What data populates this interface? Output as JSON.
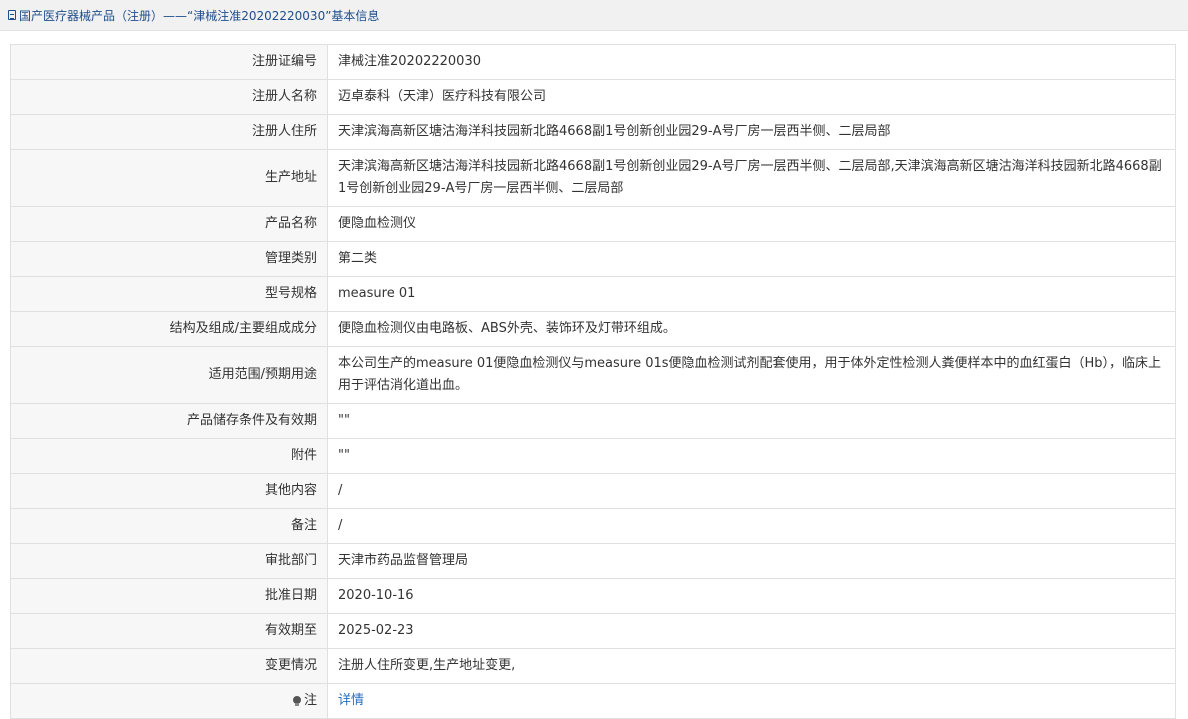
{
  "header": {
    "title": "国产医疗器械产品（注册）——“津械注准20202220030”基本信息"
  },
  "rows": [
    {
      "label": "注册证编号",
      "value": "津械注准20202220030"
    },
    {
      "label": "注册人名称",
      "value": "迈卓泰科（天津）医疗科技有限公司"
    },
    {
      "label": "注册人住所",
      "value": "天津滨海高新区塘沽海洋科技园新北路4668副1号创新创业园29-A号厂房一层西半侧、二层局部"
    },
    {
      "label": "生产地址",
      "value": "天津滨海高新区塘沽海洋科技园新北路4668副1号创新创业园29-A号厂房一层西半侧、二层局部,天津滨海高新区塘沽海洋科技园新北路4668副1号创新创业园29-A号厂房一层西半侧、二层局部"
    },
    {
      "label": "产品名称",
      "value": "便隐血检测仪"
    },
    {
      "label": "管理类别",
      "value": "第二类"
    },
    {
      "label": "型号规格",
      "value": "measure 01"
    },
    {
      "label": "结构及组成/主要组成成分",
      "value": "便隐血检测仪由电路板、ABS外壳、装饰环及灯带环组成。"
    },
    {
      "label": "适用范围/预期用途",
      "value": "本公司生产的measure 01便隐血检测仪与measure 01s便隐血检测试剂配套使用，用于体外定性检测人粪便样本中的血红蛋白（Hb），临床上用于评估消化道出血。"
    },
    {
      "label": "产品储存条件及有效期",
      "value": "\"\""
    },
    {
      "label": "附件",
      "value": "\"\""
    },
    {
      "label": "其他内容",
      "value": "/"
    },
    {
      "label": "备注",
      "value": "/"
    },
    {
      "label": "审批部门",
      "value": "天津市药品监督管理局"
    },
    {
      "label": "批准日期",
      "value": "2020-10-16"
    },
    {
      "label": "有效期至",
      "value": "2025-02-23"
    },
    {
      "label": "变更情况",
      "value": "注册人住所变更,生产地址变更,"
    }
  ],
  "note_row": {
    "label": "注",
    "link": "详情",
    "icon": "bulb-icon"
  }
}
